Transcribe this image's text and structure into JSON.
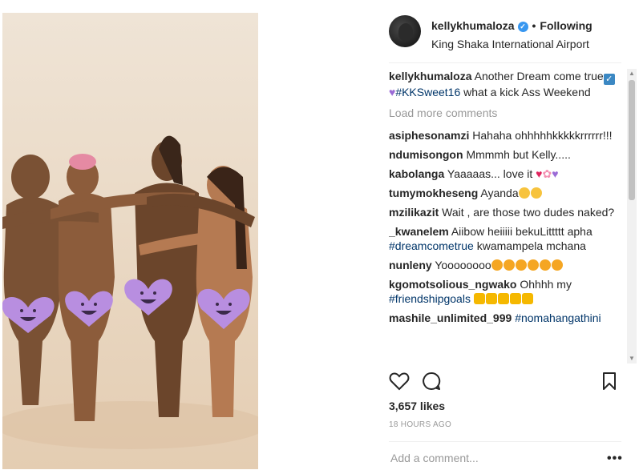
{
  "header": {
    "username": "kellykhumaloza",
    "follow_label": "Following",
    "separator": "•",
    "location": "King Shaka International Airport"
  },
  "caption": {
    "username": "kellykhumaloza",
    "text_a": "Another Dream come true",
    "hashtag": "#KKSweet16",
    "text_b": "what a kick Ass Weekend"
  },
  "load_more": "Load more comments",
  "comments": [
    {
      "user": "asiphesonamzi",
      "text": "Hahaha ohhhhhkkkkkrrrrrr!!!"
    },
    {
      "user": "ndumisongon",
      "text": "Mmmmh but Kelly....."
    },
    {
      "user": "kabolanga",
      "text": "Yaaaaas... love it"
    },
    {
      "user": "tumymokheseng",
      "text": "Ayanda"
    },
    {
      "user": "mzilikazit",
      "text": "Wait , are those two dudes naked?"
    },
    {
      "user": "_kwanelem",
      "text": "Aiibow heiiiii bekuLittttt apha",
      "tag": "#dreamcometrue",
      "text_b": "kwamampela mchana"
    },
    {
      "user": "nunleny",
      "text": "Yoooooooo"
    },
    {
      "user": "kgomotsolious_ngwako",
      "text": "Ohhhh my",
      "tag": "#friendshipgoals"
    },
    {
      "user": "mashile_unlimited_999",
      "tag": "#nomahangathini"
    }
  ],
  "likes": "3,657 likes",
  "timestamp": "18 HOURS AGO",
  "add_comment": {
    "placeholder": "Add a comment..."
  },
  "more_label": "•••",
  "colors": {
    "verified": "#3897f0",
    "heart_sticker": "#b88ee0",
    "hashtag": "#003569"
  },
  "icons": [
    "heart-icon",
    "comment-icon",
    "bookmark-icon",
    "verified-icon"
  ]
}
